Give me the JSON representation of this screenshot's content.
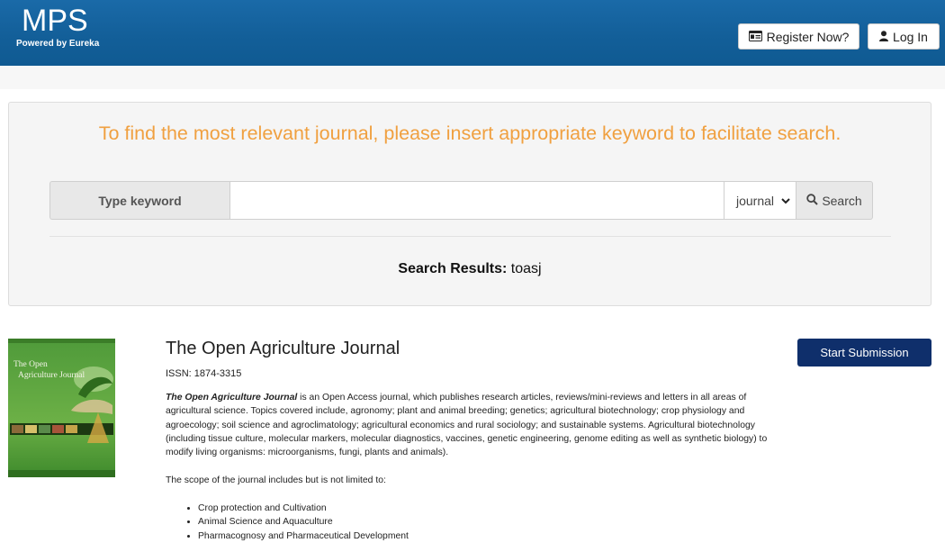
{
  "header": {
    "logo": "MPS",
    "logo_sub": "Powered by Eureka",
    "register_label": "Register Now?",
    "login_label": "Log In",
    "brand_color": "#135f99"
  },
  "search": {
    "headline": "To find the most relevant journal, please insert appropriate keyword to facilitate search.",
    "keyword_label": "Type keyword",
    "input_value": "",
    "select_value": "journal",
    "search_label": "Search",
    "results_label": "Search Results:",
    "results_query": "toasj",
    "headline_color": "#f0a040"
  },
  "result": {
    "cover_title_line1": "The Open",
    "cover_title_line2": "Agriculture Journal",
    "title": "The Open Agriculture Journal",
    "issn": "ISSN: 1874-3315",
    "desc_journal": "The Open Agriculture Journal",
    "desc_body": " is an Open Access journal, which publishes research articles, reviews/mini-reviews and letters in all areas of agricultural science. Topics covered include, agronomy; plant and animal breeding; genetics; agricultural biotechnology; crop physiology and agroecology; soil science and agroclimatology; agricultural economics and rural sociology; and sustainable systems. Agricultural biotechnology (including tissue culture, molecular markers, molecular diagnostics, vaccines, genetic engineering, genome editing as well as synthetic biology) to modify living organisms: microorganisms, fungi, plants and animals).",
    "scope_intro": "The scope of the journal includes but is not limited to:",
    "scope_items": [
      "Crop protection and Cultivation",
      "Animal Science and Aquaculture",
      "Pharmacognosy and Pharmaceutical Development"
    ],
    "submit_label": "Start Submission",
    "submit_color": "#0f2f6b"
  },
  "icons": {
    "register": "id-card-icon",
    "login": "user-icon",
    "search": "magnifier-icon",
    "select": "chevron-down-icon"
  }
}
